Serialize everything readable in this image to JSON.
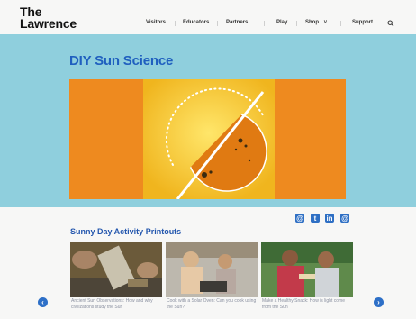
{
  "header": {
    "logo_line1": "The",
    "logo_line2": "Lawrence",
    "nav": [
      "Visitors",
      "Educators",
      "Partners",
      "Play",
      "Shop",
      "Support"
    ],
    "shop_caret": "˅"
  },
  "hero": {
    "title": "DIY Sun Science",
    "colors": {
      "background": "#8fcfdd",
      "title": "#1f5fbf",
      "orange": "#ee8a1f",
      "sun": "#f0b51e"
    }
  },
  "share": [
    "@",
    "t",
    "in",
    "@"
  ],
  "section": {
    "title": "Sunny Day Activity Printouts"
  },
  "cards": [
    {
      "caption": "Ancient Sun Observations: How and why civilizations study the Sun"
    },
    {
      "caption": "Cook with a Solar Oven: Can you cook using the Sun?"
    },
    {
      "caption": "Make a Healthy Snack: How is light come from the Sun"
    }
  ],
  "carousel": {
    "prev": "‹",
    "next": "›"
  }
}
